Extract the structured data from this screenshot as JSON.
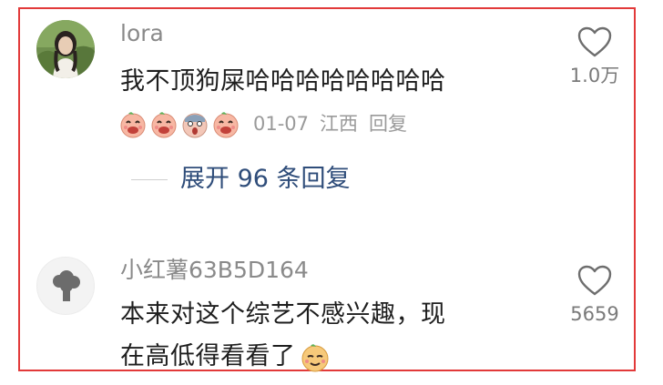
{
  "comments": [
    {
      "username": "lora",
      "text": "我不顶狗屎哈哈哈哈哈哈哈哈",
      "date": "01-07",
      "location": "江西",
      "reply_label": "回复",
      "likes": "1.0万",
      "emojis": [
        "laughing-face",
        "laughing-face",
        "screaming-face",
        "laughing-face"
      ],
      "expand_label": "展开 96 条回复"
    },
    {
      "username": "小红薯63B5D164",
      "text_line1": "本来对这个综艺不感兴趣，现",
      "text_line2": "在高低得看看了",
      "likes": "5659"
    }
  ]
}
